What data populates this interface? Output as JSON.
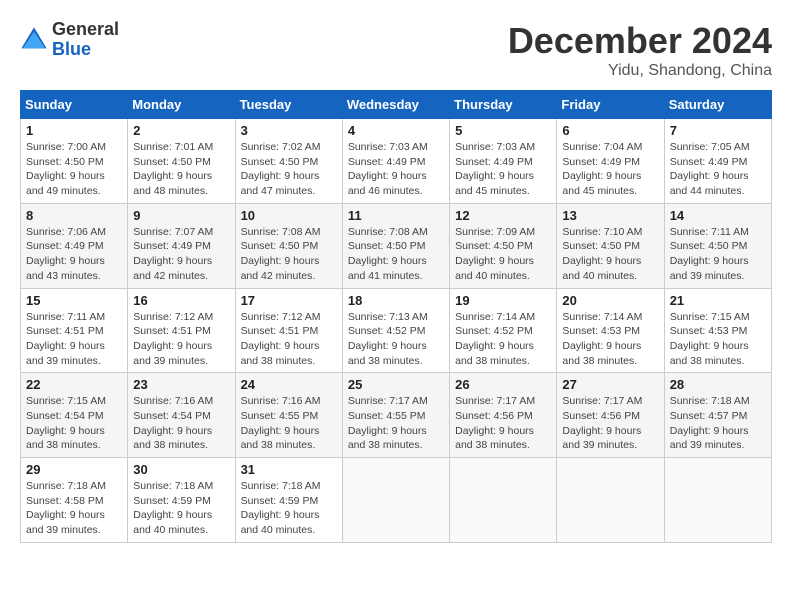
{
  "header": {
    "logo_general": "General",
    "logo_blue": "Blue",
    "title": "December 2024",
    "location": "Yidu, Shandong, China"
  },
  "days_of_week": [
    "Sunday",
    "Monday",
    "Tuesday",
    "Wednesday",
    "Thursday",
    "Friday",
    "Saturday"
  ],
  "weeks": [
    [
      {
        "day": 1,
        "sunrise": "7:00 AM",
        "sunset": "4:50 PM",
        "daylight": "9 hours and 49 minutes."
      },
      {
        "day": 2,
        "sunrise": "7:01 AM",
        "sunset": "4:50 PM",
        "daylight": "9 hours and 48 minutes."
      },
      {
        "day": 3,
        "sunrise": "7:02 AM",
        "sunset": "4:50 PM",
        "daylight": "9 hours and 47 minutes."
      },
      {
        "day": 4,
        "sunrise": "7:03 AM",
        "sunset": "4:49 PM",
        "daylight": "9 hours and 46 minutes."
      },
      {
        "day": 5,
        "sunrise": "7:03 AM",
        "sunset": "4:49 PM",
        "daylight": "9 hours and 45 minutes."
      },
      {
        "day": 6,
        "sunrise": "7:04 AM",
        "sunset": "4:49 PM",
        "daylight": "9 hours and 45 minutes."
      },
      {
        "day": 7,
        "sunrise": "7:05 AM",
        "sunset": "4:49 PM",
        "daylight": "9 hours and 44 minutes."
      }
    ],
    [
      {
        "day": 8,
        "sunrise": "7:06 AM",
        "sunset": "4:49 PM",
        "daylight": "9 hours and 43 minutes."
      },
      {
        "day": 9,
        "sunrise": "7:07 AM",
        "sunset": "4:49 PM",
        "daylight": "9 hours and 42 minutes."
      },
      {
        "day": 10,
        "sunrise": "7:08 AM",
        "sunset": "4:50 PM",
        "daylight": "9 hours and 42 minutes."
      },
      {
        "day": 11,
        "sunrise": "7:08 AM",
        "sunset": "4:50 PM",
        "daylight": "9 hours and 41 minutes."
      },
      {
        "day": 12,
        "sunrise": "7:09 AM",
        "sunset": "4:50 PM",
        "daylight": "9 hours and 40 minutes."
      },
      {
        "day": 13,
        "sunrise": "7:10 AM",
        "sunset": "4:50 PM",
        "daylight": "9 hours and 40 minutes."
      },
      {
        "day": 14,
        "sunrise": "7:11 AM",
        "sunset": "4:50 PM",
        "daylight": "9 hours and 39 minutes."
      }
    ],
    [
      {
        "day": 15,
        "sunrise": "7:11 AM",
        "sunset": "4:51 PM",
        "daylight": "9 hours and 39 minutes."
      },
      {
        "day": 16,
        "sunrise": "7:12 AM",
        "sunset": "4:51 PM",
        "daylight": "9 hours and 39 minutes."
      },
      {
        "day": 17,
        "sunrise": "7:12 AM",
        "sunset": "4:51 PM",
        "daylight": "9 hours and 38 minutes."
      },
      {
        "day": 18,
        "sunrise": "7:13 AM",
        "sunset": "4:52 PM",
        "daylight": "9 hours and 38 minutes."
      },
      {
        "day": 19,
        "sunrise": "7:14 AM",
        "sunset": "4:52 PM",
        "daylight": "9 hours and 38 minutes."
      },
      {
        "day": 20,
        "sunrise": "7:14 AM",
        "sunset": "4:53 PM",
        "daylight": "9 hours and 38 minutes."
      },
      {
        "day": 21,
        "sunrise": "7:15 AM",
        "sunset": "4:53 PM",
        "daylight": "9 hours and 38 minutes."
      }
    ],
    [
      {
        "day": 22,
        "sunrise": "7:15 AM",
        "sunset": "4:54 PM",
        "daylight": "9 hours and 38 minutes."
      },
      {
        "day": 23,
        "sunrise": "7:16 AM",
        "sunset": "4:54 PM",
        "daylight": "9 hours and 38 minutes."
      },
      {
        "day": 24,
        "sunrise": "7:16 AM",
        "sunset": "4:55 PM",
        "daylight": "9 hours and 38 minutes."
      },
      {
        "day": 25,
        "sunrise": "7:17 AM",
        "sunset": "4:55 PM",
        "daylight": "9 hours and 38 minutes."
      },
      {
        "day": 26,
        "sunrise": "7:17 AM",
        "sunset": "4:56 PM",
        "daylight": "9 hours and 38 minutes."
      },
      {
        "day": 27,
        "sunrise": "7:17 AM",
        "sunset": "4:56 PM",
        "daylight": "9 hours and 39 minutes."
      },
      {
        "day": 28,
        "sunrise": "7:18 AM",
        "sunset": "4:57 PM",
        "daylight": "9 hours and 39 minutes."
      }
    ],
    [
      {
        "day": 29,
        "sunrise": "7:18 AM",
        "sunset": "4:58 PM",
        "daylight": "9 hours and 39 minutes."
      },
      {
        "day": 30,
        "sunrise": "7:18 AM",
        "sunset": "4:59 PM",
        "daylight": "9 hours and 40 minutes."
      },
      {
        "day": 31,
        "sunrise": "7:18 AM",
        "sunset": "4:59 PM",
        "daylight": "9 hours and 40 minutes."
      },
      null,
      null,
      null,
      null
    ]
  ]
}
